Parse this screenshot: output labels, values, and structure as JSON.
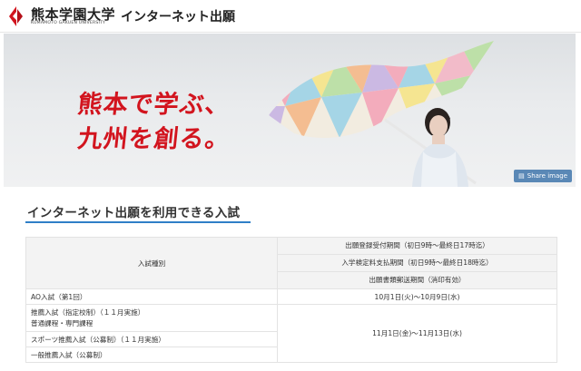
{
  "header": {
    "logo_jp": "熊本学園大学",
    "logo_en": "KUMAMOTO GAKUEN UNIVERSITY",
    "title": "インターネット出願"
  },
  "hero": {
    "line1": "熊本で学ぶ、",
    "line2": "九州を創る。",
    "share_label": "Share image",
    "share_icon": "share-icon"
  },
  "section": {
    "title": "インターネット出願を利用できる入試"
  },
  "table": {
    "type_header": "入試種別",
    "period_headers": [
      "出願登録受付期間（初日9時～最終日17時迄）",
      "入学検定料支払期間（初日9時～最終日18時迄）",
      "出願書類郵送期間（消印有効）"
    ],
    "rows": [
      {
        "name": "AO入試（第1回）",
        "period": "10月1日(火)～10月9日(水)"
      },
      {
        "name_line1": "推薦入試（指定校制）（１１月実施）",
        "name_line2": "普通課程・専門課程"
      },
      {
        "name": "スポーツ推薦入試（公募制）（１１月実施）"
      },
      {
        "name": "一般推薦入試（公募制）"
      }
    ],
    "shared_period": "11月1日(金)～11月13日(水)"
  },
  "colors": {
    "brand_red": "#d2141e",
    "accent_blue": "#2f7fc7",
    "share_button": "#5a88b6"
  }
}
